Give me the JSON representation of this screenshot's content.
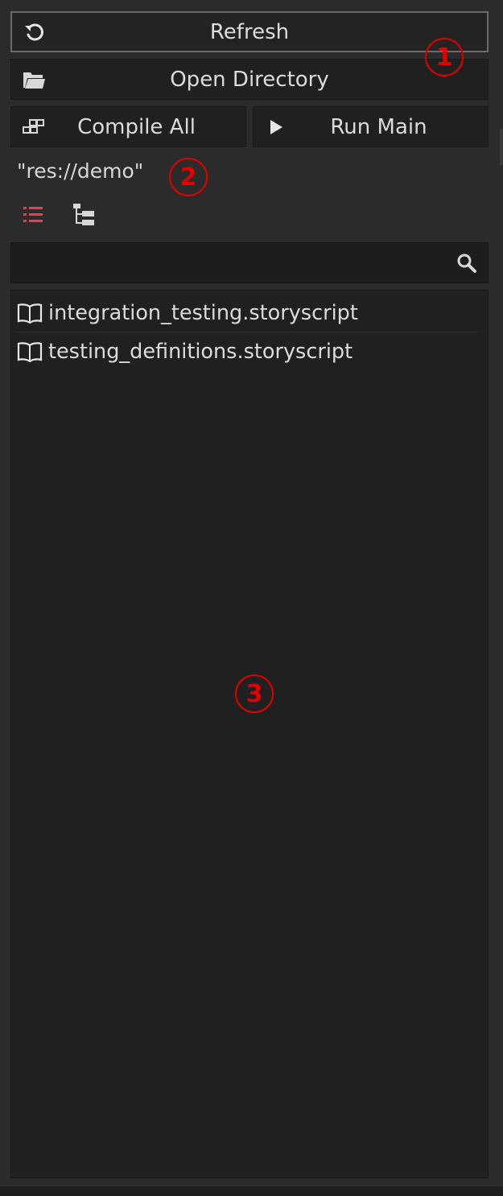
{
  "toolbar": {
    "refresh_label": "Refresh",
    "open_directory_label": "Open Directory",
    "compile_all_label": "Compile All",
    "run_main_label": "Run Main"
  },
  "path": {
    "current": "\"res://demo\""
  },
  "search": {
    "value": "",
    "placeholder": ""
  },
  "files": [
    {
      "name": "integration_testing.storyscript",
      "icon": "book-icon"
    },
    {
      "name": "testing_definitions.storyscript",
      "icon": "book-icon"
    }
  ],
  "annotations": {
    "one": "1",
    "two": "2",
    "three": "3"
  },
  "colors": {
    "panel_bg": "#2b2b2b",
    "button_bg": "#202020",
    "list_bg": "#202020",
    "accent_red": "#e0405a",
    "annotation_red": "#e00000"
  },
  "view_mode": {
    "active": "list"
  }
}
